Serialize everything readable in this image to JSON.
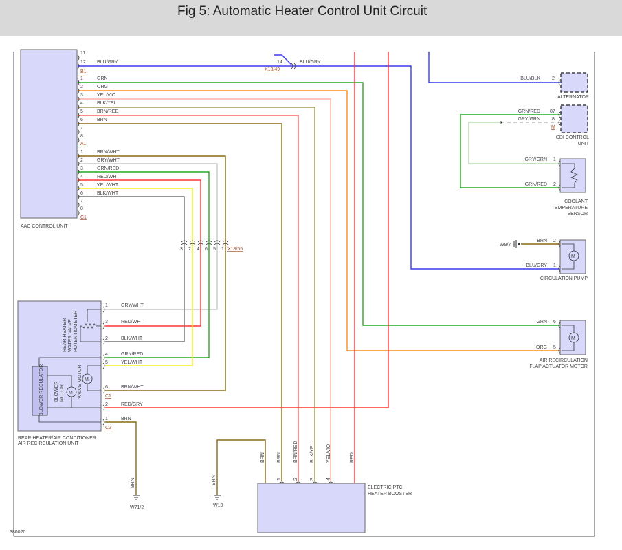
{
  "title": "Fig 5: Automatic Heater Control Unit Circuit",
  "figure_id": "380020",
  "components": {
    "aac": "AAC CONTROL UNIT",
    "rear_unit": [
      "REAR HEATER/AIR CONDITIONER",
      "AIR RECIRCULATION UNIT"
    ],
    "potentiometer": [
      "REAR HEATER",
      "WATER VALVE",
      "POTENTIOMETER"
    ],
    "valve_motor": "VALVE MOTOR",
    "blower_motor": [
      "BLOWER",
      "MOTOR"
    ],
    "blower_regulator": "BLOWER REGULATOR",
    "ptc": [
      "ELECTRIC PTC",
      "HEATER BOOSTER"
    ],
    "alternator": "ALTERNATOR",
    "cdi": [
      "CDI CONTROL",
      "UNIT"
    ],
    "coolant": [
      "COOLANT",
      "TEMPERATURE",
      "SENSOR"
    ],
    "pump": "CIRCULATION PUMP",
    "flap": [
      "AIR RECIRCULATION",
      "FLAP ACTUATOR MOTOR"
    ],
    "motor_symbol": "M"
  },
  "connectors": {
    "b1": "B1",
    "a1": "A1",
    "c1": "C1",
    "rear_c1": "C1",
    "rear_c2": "C2",
    "cdi_m": "M",
    "x18_49": "X18/49",
    "x18_49_pin": "14",
    "x18_55": "X18/55"
  },
  "grounds": {
    "w71": "W71/2",
    "w10": "W10",
    "w97": "W9/7"
  },
  "aac_pins": {
    "b1": [
      "11",
      "12"
    ],
    "a1": [
      "1",
      "2",
      "3",
      "4",
      "5",
      "6",
      "7",
      "8"
    ],
    "c1": [
      "1",
      "2",
      "3",
      "4",
      "5",
      "6",
      "7",
      "8"
    ]
  },
  "aac_wires": {
    "b1": [
      "BLU/GRY"
    ],
    "a1": [
      "GRN",
      "ORG",
      "YEL/VIO",
      "BLK/YEL",
      "BRN/RED",
      "BRN"
    ],
    "c1": [
      "BRN/WHT",
      "GRY/WHT",
      "GRN/RED",
      "RED/WHT",
      "YEL/WHT",
      "BLK/WHT"
    ]
  },
  "x18_49_wire": "BLU/GRY",
  "x18_55_pins": [
    "3",
    "2",
    "4",
    "6",
    "5",
    "1"
  ],
  "rear_pins": [
    {
      "pin": "1",
      "wire": "GRY/WHT"
    },
    {
      "pin": "3",
      "wire": "RED/WHT"
    },
    {
      "pin": "2",
      "wire": "BLK/WHT"
    },
    {
      "pin": "4",
      "wire": "GRN/RED"
    },
    {
      "pin": "5",
      "wire": "YEL/WHT"
    },
    {
      "pin": "6",
      "wire": "BRN/WHT"
    },
    {
      "pin": "2",
      "wire": "RED/GRY"
    },
    {
      "pin": "1",
      "wire": "BRN"
    }
  ],
  "ground_wires": {
    "w71": "BRN",
    "w10": "BRN"
  },
  "ptc_wires": [
    "BRN",
    "BRN",
    "BRN/RED",
    "BLK/YEL",
    "YEL/VIO",
    "RED"
  ],
  "ptc_pins": [
    "1",
    "2",
    "3",
    "4"
  ],
  "right": {
    "alternator": {
      "wire": "BLU/BLK",
      "pin": "2"
    },
    "cdi": [
      {
        "wire": "GRN/RED",
        "pin": "87"
      },
      {
        "wire": "GRY/GRN",
        "pin": "8"
      }
    ],
    "coolant": [
      {
        "wire": "GRY/GRN",
        "pin": "1"
      },
      {
        "wire": "GRN/RED",
        "pin": "2"
      }
    ],
    "pump": [
      {
        "wire": "BRN",
        "pin": "2"
      },
      {
        "wire": "BLU/GRY",
        "pin": "1"
      }
    ],
    "flap": [
      {
        "wire": "GRN",
        "pin": "6"
      },
      {
        "wire": "ORG",
        "pin": "5"
      }
    ]
  },
  "wire_colors": {
    "blue": "#3a3af0",
    "green": "#22aa22",
    "orange": "#ff8a1a",
    "red": "#ff3333",
    "brown": "#8b6914",
    "gray": "#c8c8c8",
    "yellow": "#f0f020",
    "dark_gray": "#707070",
    "pink": "#ffa0a0",
    "olive": "#a09a50",
    "light_green": "#b8d8b0"
  },
  "component_fill": "#d8d8fb"
}
